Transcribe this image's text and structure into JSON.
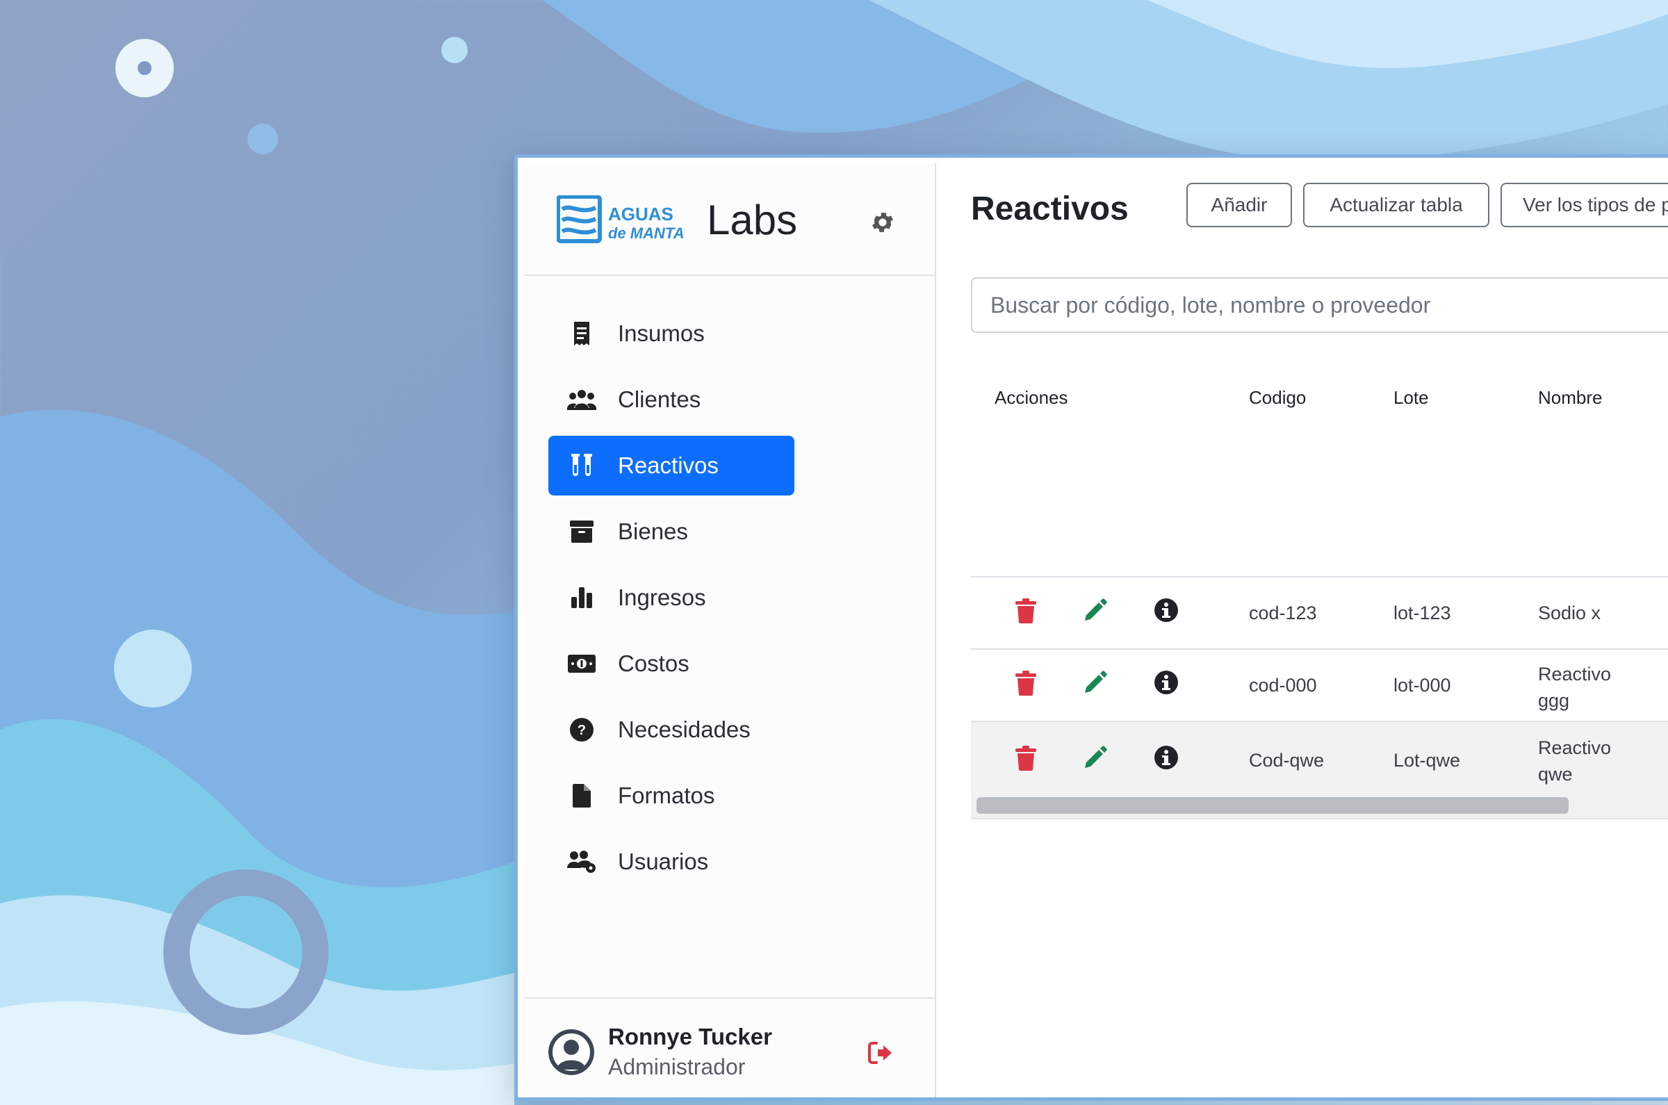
{
  "app": {
    "logo_text_1": "AGUAS",
    "logo_text_2": "de MANTA",
    "name": "Labs"
  },
  "sidebar": {
    "items": [
      {
        "label": "Insumos",
        "icon": "receipt-icon"
      },
      {
        "label": "Clientes",
        "icon": "people-group-icon"
      },
      {
        "label": "Reactivos",
        "icon": "test-tubes-icon",
        "active": true
      },
      {
        "label": "Bienes",
        "icon": "archive-box-icon"
      },
      {
        "label": "Ingresos",
        "icon": "bar-chart-icon"
      },
      {
        "label": "Costos",
        "icon": "money-bill-icon"
      },
      {
        "label": "Necesidades",
        "icon": "question-circle-icon"
      },
      {
        "label": "Formatos",
        "icon": "file-icon"
      },
      {
        "label": "Usuarios",
        "icon": "users-gear-icon"
      }
    ],
    "user": {
      "name": "Ronnye Tucker",
      "role": "Administrador"
    }
  },
  "main": {
    "title": "Reactivos",
    "buttons": {
      "add": "Añadir",
      "refresh": "Actualizar tabla",
      "types": "Ver los tipos de prese"
    },
    "search_placeholder": "Buscar por código, lote, nombre o proveedor",
    "table": {
      "headers": {
        "actions": "Acciones",
        "code": "Codigo",
        "lot": "Lote",
        "name": "Nombre"
      },
      "rows": [
        {
          "code": "cod-123",
          "lot": "lot-123",
          "name": "Sodio x"
        },
        {
          "code": "cod-000",
          "lot": "lot-000",
          "name": "Reactivo ggg"
        },
        {
          "code": "Cod-qwe",
          "lot": "Lot-qwe",
          "name": "Reactivo qwe"
        }
      ]
    }
  },
  "colors": {
    "accent": "#0d6efd",
    "delete": "#dc3545",
    "edit": "#198754",
    "logout": "#dc3545"
  }
}
